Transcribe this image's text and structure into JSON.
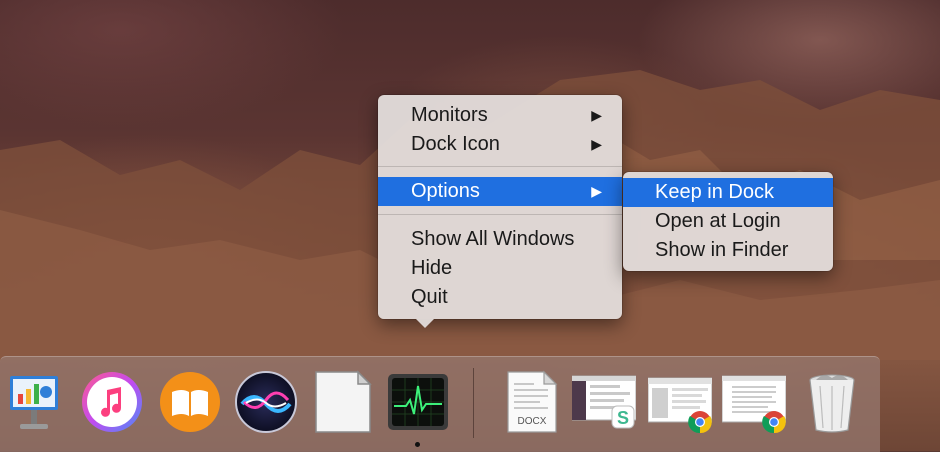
{
  "context_menu": {
    "items": [
      {
        "label": "Monitors",
        "submenu": true
      },
      {
        "label": "Dock Icon",
        "submenu": true
      },
      {
        "label": "Options",
        "submenu": true,
        "active": true
      },
      {
        "label": "Show All Windows"
      },
      {
        "label": "Hide"
      },
      {
        "label": "Quit"
      }
    ],
    "arrow": "▶"
  },
  "submenu": {
    "items": [
      {
        "label": "Keep in Dock",
        "active": true
      },
      {
        "label": "Open at Login"
      },
      {
        "label": "Show in Finder"
      }
    ]
  },
  "dock": {
    "apps": [
      {
        "name": "keynote-icon"
      },
      {
        "name": "itunes-icon"
      },
      {
        "name": "ibooks-icon"
      },
      {
        "name": "siri-icon"
      },
      {
        "name": "libreoffice-icon"
      },
      {
        "name": "activity-monitor-icon",
        "running": true
      }
    ],
    "files": [
      {
        "name": "docx-document-icon",
        "label": "DOCX"
      },
      {
        "name": "slack-screenshot-icon"
      },
      {
        "name": "chrome-screenshot-icon"
      },
      {
        "name": "chrome-document-icon"
      },
      {
        "name": "trash-icon"
      }
    ]
  },
  "colors": {
    "highlight": "#1f6fe0",
    "menu_bg": "#e2dcda"
  }
}
